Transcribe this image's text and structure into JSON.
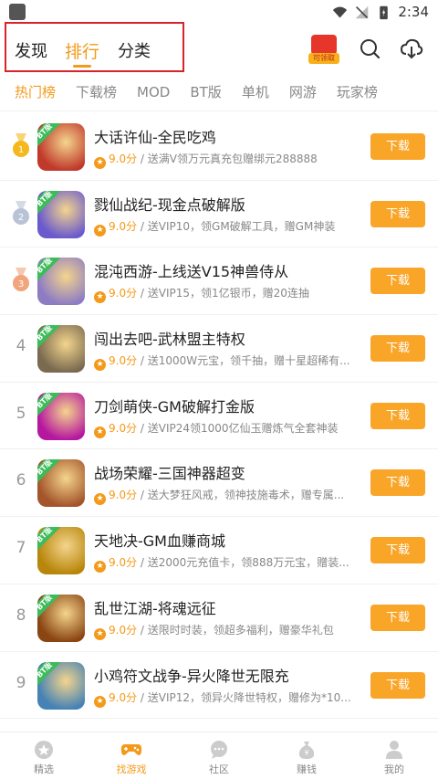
{
  "status": {
    "time": "2:34"
  },
  "top_tabs": [
    {
      "label": "发现"
    },
    {
      "label": "排行"
    },
    {
      "label": "分类"
    }
  ],
  "gift_label": "可领取",
  "sub_tabs": [
    {
      "label": "热门榜"
    },
    {
      "label": "下载榜"
    },
    {
      "label": "MOD"
    },
    {
      "label": "BT版"
    },
    {
      "label": "单机"
    },
    {
      "label": "网游"
    },
    {
      "label": "玩家榜"
    }
  ],
  "download_label": "下载",
  "games": [
    {
      "rank": "1",
      "title": "大话许仙-全民吃鸡",
      "score": "9.0分",
      "desc": " / 送满V领万元真充包赠绑元288888",
      "color": "#c0392b"
    },
    {
      "rank": "2",
      "title": "戮仙战纪-现金点破解版",
      "score": "9.0分",
      "desc": " / 送VIP10，领GM破解工具，赠GM神装",
      "color": "#6a5acd"
    },
    {
      "rank": "3",
      "title": "混沌西游-上线送V15神兽侍从",
      "score": "9.0分",
      "desc": " / 送VIP15，领1亿银币，赠20连抽",
      "color": "#8e7cc3"
    },
    {
      "rank": "4",
      "title": "闯出去吧-武林盟主特权",
      "score": "9.0分",
      "desc": " / 送1000W元宝，领千抽，赠十星超稀有...",
      "color": "#7a6a4f"
    },
    {
      "rank": "5",
      "title": "刀剑萌侠-GM破解打金版",
      "score": "9.0分",
      "desc": " / 送VIP24领1000亿仙玉赠炼气全套神装",
      "color": "#b5179e"
    },
    {
      "rank": "6",
      "title": "战场荣耀-三国神器超变",
      "score": "9.0分",
      "desc": " / 送大梦狂风戒，领神技施毒术，赠专属...",
      "color": "#a4552b"
    },
    {
      "rank": "7",
      "title": "天地决-GM血赚商城",
      "score": "9.0分",
      "desc": " / 送2000元充值卡，领888万元宝，赠装...",
      "color": "#b8860b"
    },
    {
      "rank": "8",
      "title": "乱世江湖-将魂远征",
      "score": "9.0分",
      "desc": " / 送限时时装，领超多福利，赠豪华礼包",
      "color": "#8b4513"
    },
    {
      "rank": "9",
      "title": "小鸡符文战争-异火降世无限充",
      "score": "9.0分",
      "desc": " / 送VIP12，领异火降世特权，赠修为*10...",
      "color": "#4682b4"
    }
  ],
  "bottom_nav": [
    {
      "label": "精选"
    },
    {
      "label": "找游戏"
    },
    {
      "label": "社区"
    },
    {
      "label": "赚钱"
    },
    {
      "label": "我的"
    }
  ]
}
